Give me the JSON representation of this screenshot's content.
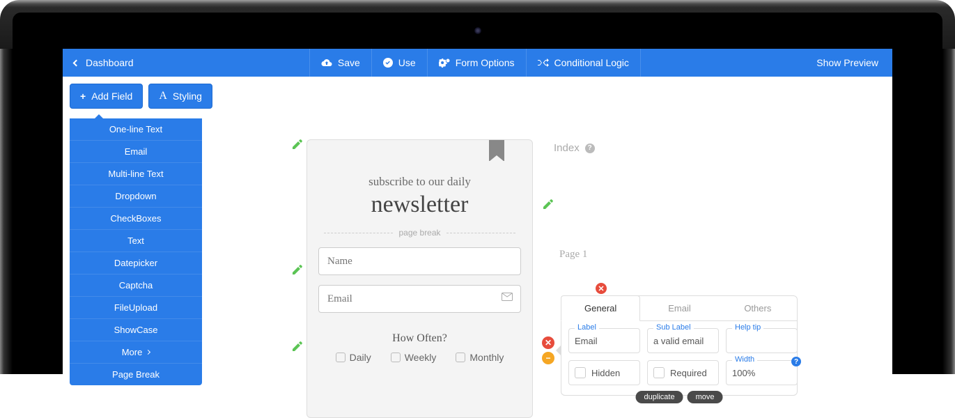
{
  "topbar": {
    "back": "Dashboard",
    "save": "Save",
    "use": "Use",
    "form_options": "Form Options",
    "conditional": "Conditional Logic",
    "preview": "Show Preview"
  },
  "toolbar": {
    "add_field": "Add Field",
    "styling": "Styling"
  },
  "field_menu": {
    "items": [
      "One-line Text",
      "Email",
      "Multi-line Text",
      "Dropdown",
      "CheckBoxes",
      "Text",
      "Datepicker",
      "Captcha",
      "FileUpload",
      "ShowCase"
    ],
    "more": "More",
    "page_break": "Page Break"
  },
  "form": {
    "subtitle": "subscribe to our daily",
    "title": "newsletter",
    "page_break": "page break",
    "name_ph": "Name",
    "email_ph": "Email",
    "how_often": "How Often?",
    "options": [
      "Daily",
      "Weekly",
      "Monthly"
    ]
  },
  "index": {
    "title": "Index",
    "page": "Page 1"
  },
  "props": {
    "tabs": [
      "General",
      "Email",
      "Others"
    ],
    "label_t": "Label",
    "label_v": "Email",
    "sub_t": "Sub Label",
    "sub_v": "a valid email",
    "help_t": "Help tip",
    "help_v": "",
    "hidden": "Hidden",
    "required": "Required",
    "width_t": "Width",
    "width_v": "100%",
    "duplicate": "duplicate",
    "move": "move"
  }
}
